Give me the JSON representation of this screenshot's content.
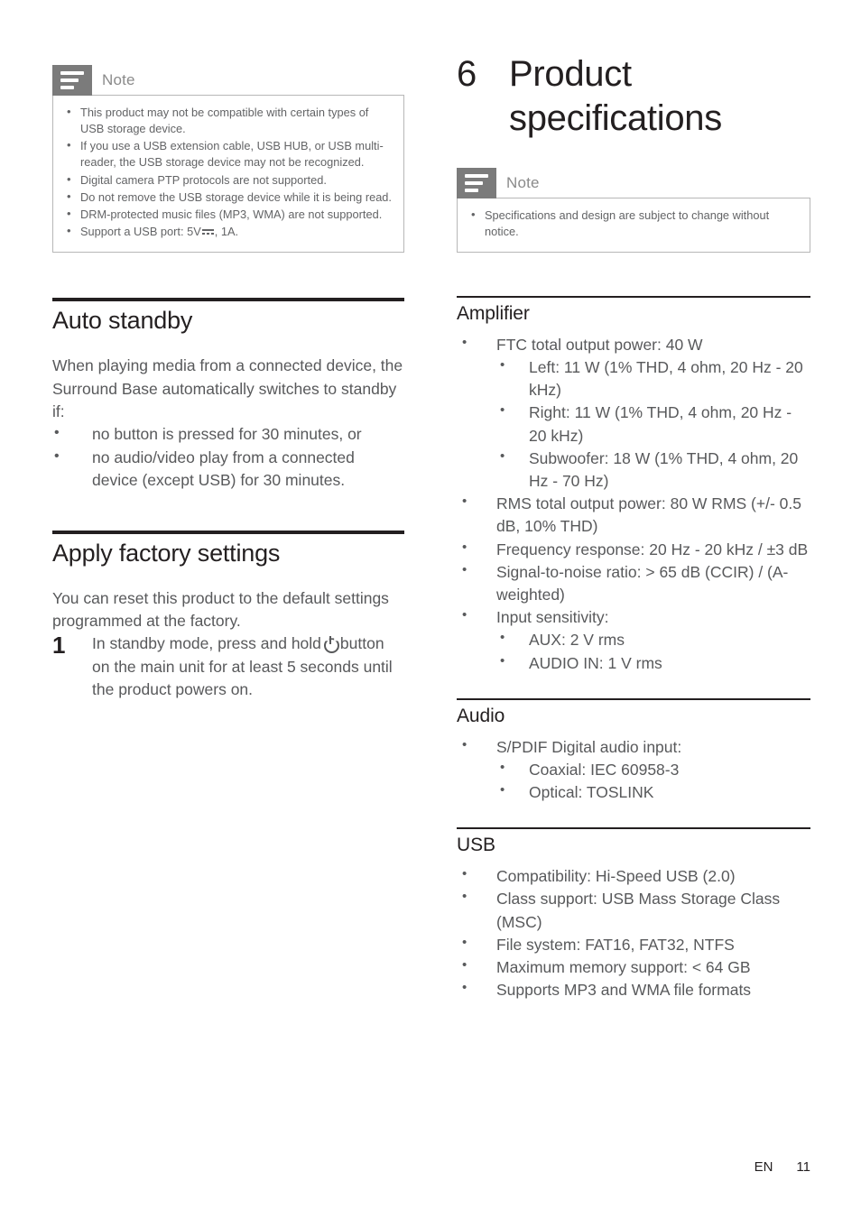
{
  "footer": {
    "lang": "EN",
    "page": "11"
  },
  "left_column": {
    "note": {
      "icon": "note-lines-icon",
      "title": "Note",
      "items": [
        "This product may not be compatible with certain types of USB storage device.",
        "If you use a USB extension cable, USB HUB, or USB multi-reader, the USB storage device may not be recognized.",
        "Digital camera PTP protocols are not supported.",
        "Do not remove the USB storage device while it is being read.",
        "DRM-protected music files (MP3, WMA) are not supported.",
        "Support a USB port: 5V"
      ],
      "usb_port_suffix": ", 1A."
    },
    "auto_standby": {
      "heading": "Auto standby",
      "paragraph": "When playing media from a connected device, the Surround Base automatically switches to standby if:",
      "bullets": [
        "no button is pressed for 30 minutes, or",
        "no audio/video play from a connected device (except USB) for 30 minutes."
      ]
    },
    "apply_factory_settings": {
      "heading": "Apply factory settings",
      "paragraph": "You can reset this product to the default settings programmed at the factory.",
      "step1_pre": "In standby mode, press and hold",
      "step1_post": "button on the main unit for at least 5 seconds until the product powers on."
    }
  },
  "right_column": {
    "chapter": {
      "number": "6",
      "title": "Product specifications"
    },
    "note": {
      "icon": "note-lines-icon",
      "title": "Note",
      "items": [
        "Specifications and design are subject to change without notice."
      ]
    },
    "sections": [
      {
        "heading": "Amplifier",
        "items": [
          {
            "text": "FTC total output power: 40 W",
            "sub": [
              "Left: 11 W (1% THD, 4 ohm, 20 Hz - 20 kHz)",
              "Right: 11 W (1% THD, 4 ohm, 20 Hz - 20 kHz)",
              "Subwoofer: 18 W (1% THD, 4 ohm, 20 Hz - 70 Hz)"
            ]
          },
          {
            "text": "RMS total output power: 80 W RMS (+/- 0.5 dB, 10% THD)",
            "sub": []
          },
          {
            "text": "Frequency response: 20 Hz - 20 kHz / ±3 dB",
            "sub": []
          },
          {
            "text": "Signal-to-noise ratio: > 65 dB (CCIR) / (A-weighted)",
            "sub": []
          },
          {
            "text": "Input sensitivity:",
            "sub": [
              "AUX: 2 V rms",
              "AUDIO IN: 1 V rms"
            ]
          }
        ]
      },
      {
        "heading": "Audio",
        "items": [
          {
            "text": "S/PDIF Digital audio input:",
            "sub": [
              "Coaxial: IEC 60958-3",
              "Optical: TOSLINK"
            ]
          }
        ]
      },
      {
        "heading": "USB",
        "items": [
          {
            "text": "Compatibility: Hi-Speed USB (2.0)",
            "sub": []
          },
          {
            "text": "Class support: USB Mass Storage Class (MSC)",
            "sub": []
          },
          {
            "text": "File system: FAT16, FAT32, NTFS",
            "sub": []
          },
          {
            "text": "Maximum memory support: < 64 GB",
            "sub": []
          },
          {
            "text": "Supports MP3 and WMA file formats",
            "sub": []
          }
        ]
      }
    ]
  }
}
